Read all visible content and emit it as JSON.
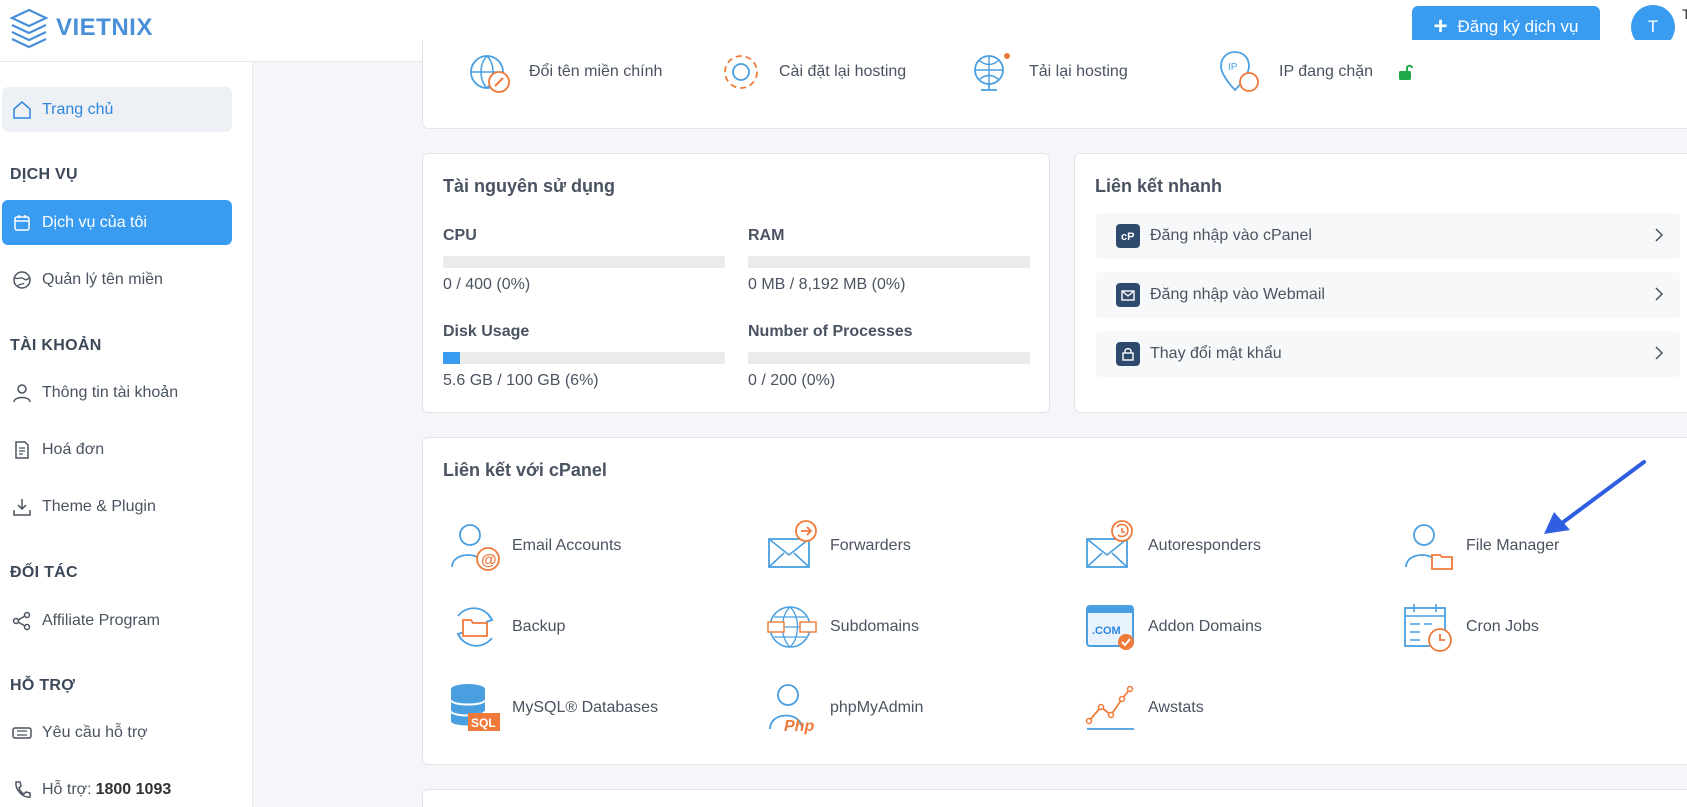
{
  "brand": {
    "name": "VIETNIX"
  },
  "header": {
    "register_label": "Đăng ký dịch vụ",
    "avatar_initial": "T",
    "avatar_name": "T"
  },
  "sidebar": {
    "home": "Trang chủ",
    "sections": {
      "services": "DỊCH VỤ",
      "account": "TÀI KHOẢN",
      "partners": "ĐỐI TÁC",
      "support": "HỖ TRỢ"
    },
    "items": {
      "my_services": "Dịch vụ của tôi",
      "domains": "Quản lý tên miền",
      "account_info": "Thông tin tài khoản",
      "invoices": "Hoá đơn",
      "themes": "Theme & Plugin",
      "affiliate": "Affiliate Program",
      "ticket": "Yêu cầu hỗ trợ",
      "hotline_label": "Hỗ trợ:",
      "hotline_number": "1800 1093"
    }
  },
  "tools": [
    {
      "label": "Đổi tên miền chính",
      "icon": "globe-edit-icon"
    },
    {
      "label": "Cài đặt lại hosting",
      "icon": "gear-reset-icon"
    },
    {
      "label": "Tải lại hosting",
      "icon": "server-reload-icon"
    },
    {
      "label": "IP đang chặn",
      "icon": "ip-block-icon"
    }
  ],
  "resources": {
    "title": "Tài nguyên sử dụng",
    "cpu": {
      "label": "CPU",
      "value": "0 / 400 (0%)",
      "percent": 0
    },
    "ram": {
      "label": "RAM",
      "value": "0 MB / 8,192 MB (0%)",
      "percent": 0
    },
    "disk": {
      "label": "Disk Usage",
      "value": "5.6 GB / 100 GB (6%)",
      "percent": 6
    },
    "processes": {
      "label": "Number of Processes",
      "value": "0 / 200 (0%)",
      "percent": 0
    }
  },
  "quick_links": {
    "title": "Liên kết nhanh",
    "items": [
      {
        "label": "Đăng nhập vào cPanel",
        "icon": "cpanel-icon"
      },
      {
        "label": "Đăng nhập vào Webmail",
        "icon": "mail-icon"
      },
      {
        "label": "Thay đổi mật khẩu",
        "icon": "lock-icon"
      }
    ]
  },
  "cpanel_links": {
    "title": "Liên kết với cPanel",
    "items": [
      {
        "label": "Email Accounts",
        "icon": "email-accounts-icon"
      },
      {
        "label": "Forwarders",
        "icon": "forwarders-icon"
      },
      {
        "label": "Autoresponders",
        "icon": "autoresponders-icon"
      },
      {
        "label": "File Manager",
        "icon": "file-manager-icon"
      },
      {
        "label": "Backup",
        "icon": "backup-icon"
      },
      {
        "label": "Subdomains",
        "icon": "subdomains-icon"
      },
      {
        "label": "Addon Domains",
        "icon": "addon-domains-icon"
      },
      {
        "label": "Cron Jobs",
        "icon": "cron-jobs-icon"
      },
      {
        "label": "MySQL® Databases",
        "icon": "mysql-icon"
      },
      {
        "label": "phpMyAdmin",
        "icon": "phpmyadmin-icon"
      },
      {
        "label": "Awstats",
        "icon": "awstats-icon"
      }
    ]
  },
  "colors": {
    "primary": "#3a9cf0",
    "icon_blue": "#4a9fe0",
    "icon_orange": "#f07a3a",
    "dark_icon": "#2f4a6d",
    "annotation_arrow": "#2f5fe0",
    "lock_green": "#1fa84a"
  }
}
